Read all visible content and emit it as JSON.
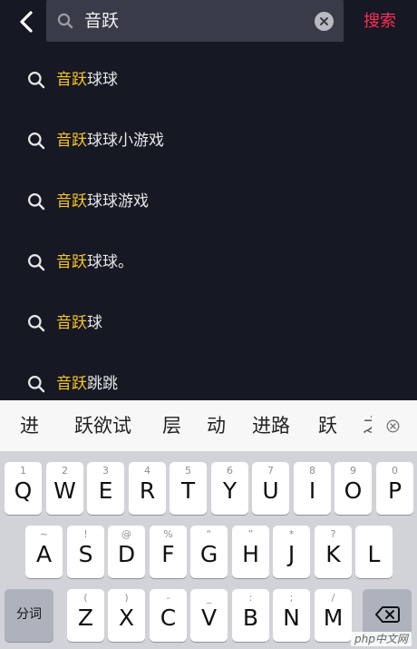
{
  "search": {
    "query": "音跃",
    "submit_label": "搜索"
  },
  "suggestions": [
    {
      "highlight": "音跃",
      "rest": "球球"
    },
    {
      "highlight": "音跃",
      "rest": "球球小游戏"
    },
    {
      "highlight": "音跃",
      "rest": "球球游戏"
    },
    {
      "highlight": "音跃",
      "rest": "球球。"
    },
    {
      "highlight": "音跃",
      "rest": "球"
    },
    {
      "highlight": "音跃",
      "rest": "跳跳"
    }
  ],
  "candidates": [
    "进",
    "跃欲试",
    "层",
    "动",
    "进路",
    "跃",
    "之"
  ],
  "keyboard": {
    "row1": [
      {
        "hint": "1",
        "key": "Q"
      },
      {
        "hint": "2",
        "key": "W"
      },
      {
        "hint": "3",
        "key": "E"
      },
      {
        "hint": "4",
        "key": "R"
      },
      {
        "hint": "5",
        "key": "T"
      },
      {
        "hint": "6",
        "key": "Y"
      },
      {
        "hint": "7",
        "key": "U"
      },
      {
        "hint": "8",
        "key": "I"
      },
      {
        "hint": "9",
        "key": "O"
      },
      {
        "hint": "0",
        "key": "P"
      }
    ],
    "row2": [
      {
        "hint": "~",
        "key": "A"
      },
      {
        "hint": "!",
        "key": "S"
      },
      {
        "hint": "@",
        "key": "D"
      },
      {
        "hint": "%",
        "key": "F"
      },
      {
        "hint": "“",
        "key": "G"
      },
      {
        "hint": "”",
        "key": "H"
      },
      {
        "hint": "*",
        "key": "J"
      },
      {
        "hint": "?",
        "key": "K"
      },
      {
        "hint": "",
        "key": "L"
      }
    ],
    "row3": [
      {
        "hint": "(",
        "key": "Z"
      },
      {
        "hint": ")",
        "key": "X"
      },
      {
        "hint": "-",
        "key": "C"
      },
      {
        "hint": "_",
        "key": "V"
      },
      {
        "hint": ":",
        "key": "B"
      },
      {
        "hint": ";",
        "key": "N"
      },
      {
        "hint": "/",
        "key": "M"
      }
    ],
    "shift_label": "分词"
  },
  "watermark": "php中文网",
  "colors": {
    "background": "#161823",
    "highlight": "#f5c526",
    "accent": "#fe2c55"
  }
}
